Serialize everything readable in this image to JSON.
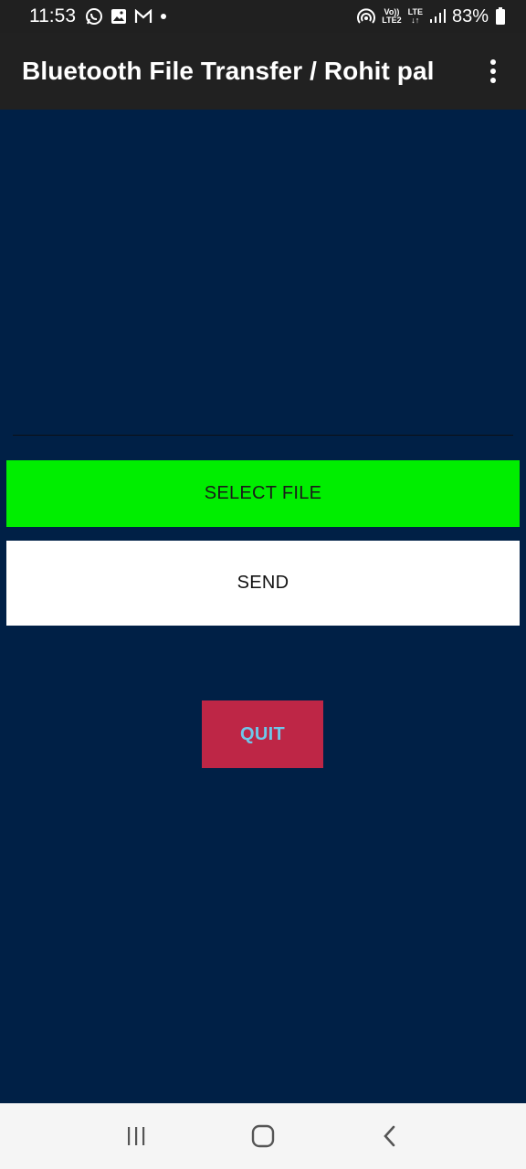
{
  "status_bar": {
    "time": "11:53",
    "network_top": "Vo))",
    "network_bottom": "LTE2",
    "lte_top": "LTE",
    "lte_bottom": "↓↑",
    "battery": "83%",
    "icons": [
      "whatsapp-icon",
      "gallery-icon",
      "gmail-icon",
      "dot-icon",
      "hotspot-icon",
      "signal-icon",
      "battery-icon"
    ]
  },
  "app_bar": {
    "title": "Bluetooth File Transfer / Rohit pal",
    "menu_icon": "more-vert-icon"
  },
  "buttons": {
    "select_file": "SELECT FILE",
    "send": "SEND",
    "quit": "QUIT"
  },
  "colors": {
    "background": "#002046",
    "app_bar": "#212121",
    "select_button": "#00ee00",
    "send_button": "#ffffff",
    "quit_button": "#be2646",
    "quit_text": "#6ec7ea"
  },
  "nav_bar": {
    "icons": [
      "recent-apps-icon",
      "home-icon",
      "back-icon"
    ]
  }
}
